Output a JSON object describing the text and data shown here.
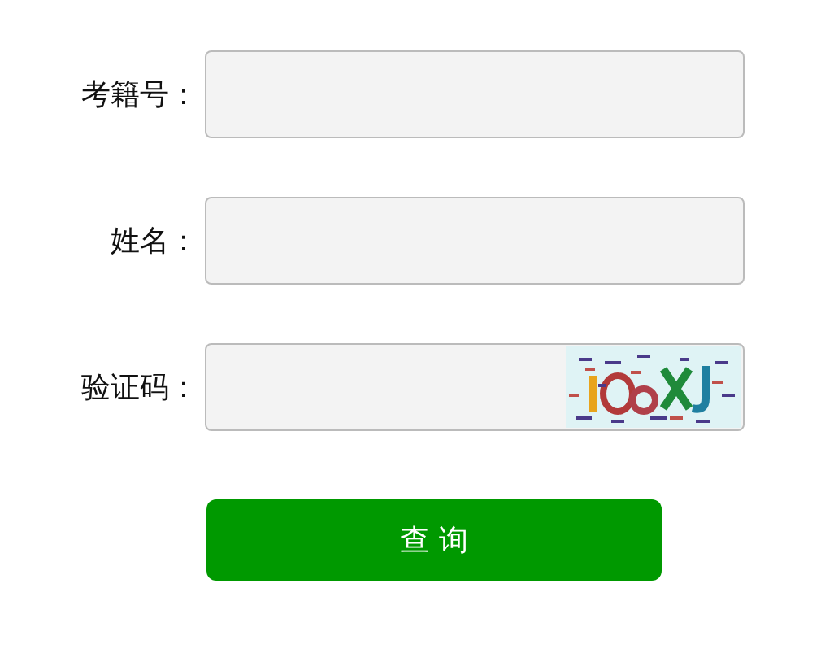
{
  "fields": [
    {
      "label": "考籍号：",
      "kind": "text"
    },
    {
      "label": "姓名：",
      "kind": "text"
    },
    {
      "label": "验证码：",
      "kind": "captcha"
    }
  ],
  "submit_button": {
    "label": "查 询"
  }
}
